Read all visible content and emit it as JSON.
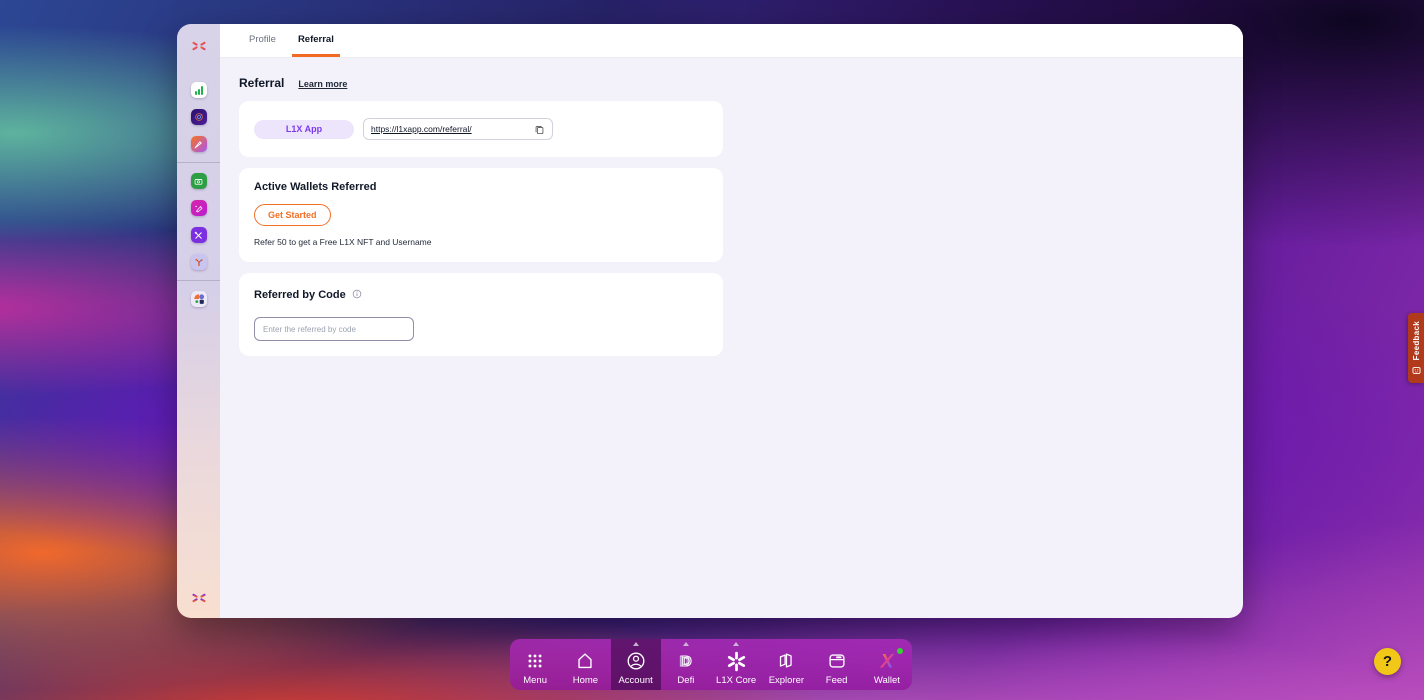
{
  "window": {
    "tabs": [
      {
        "label": "Profile",
        "active": false
      },
      {
        "label": "Referral",
        "active": true
      }
    ],
    "page": {
      "title": "Referral",
      "learn_more": "Learn more"
    },
    "cards": {
      "link": {
        "network_label": "L1X App",
        "url": "https://l1xapp.com/referral/"
      },
      "wallets": {
        "title": "Active Wallets Referred",
        "button": "Get Started",
        "note": "Refer 50 to get a Free L1X NFT and Username"
      },
      "code": {
        "title": "Referred by Code",
        "placeholder": "Enter the referred by code"
      }
    }
  },
  "sidebar": {
    "icons": [
      {
        "name": "l1x-logo"
      },
      {
        "name": "analytics-app"
      },
      {
        "name": "core-app"
      },
      {
        "name": "launch-app"
      },
      {
        "name": "finance-app"
      },
      {
        "name": "create-app"
      },
      {
        "name": "tools-app"
      },
      {
        "name": "network-app"
      },
      {
        "name": "apps-grid"
      },
      {
        "name": "l1x-logo-bottom"
      }
    ]
  },
  "dock": {
    "items": [
      {
        "label": "Menu",
        "active": false,
        "indicator": false
      },
      {
        "label": "Home",
        "active": false,
        "indicator": false
      },
      {
        "label": "Account",
        "active": true,
        "indicator": true
      },
      {
        "label": "Defi",
        "active": false,
        "indicator": true
      },
      {
        "label": "L1X Core",
        "active": false,
        "indicator": true
      },
      {
        "label": "Explorer",
        "active": false,
        "indicator": false
      },
      {
        "label": "Feed",
        "active": false,
        "indicator": false
      },
      {
        "label": "Wallet",
        "active": false,
        "indicator": false,
        "badge": "online"
      }
    ]
  },
  "feedback": {
    "label": "Feedback"
  },
  "help": {
    "label": "?"
  },
  "colors": {
    "accent_orange": "#f26a21",
    "accent_purple": "#7c3aed",
    "pill_bg": "#ece5fb",
    "feedback_bg": "#b13a1d",
    "help_bg": "#f2c818",
    "dock_bg": "#a21baa",
    "content_bg": "#f3f1fa"
  }
}
